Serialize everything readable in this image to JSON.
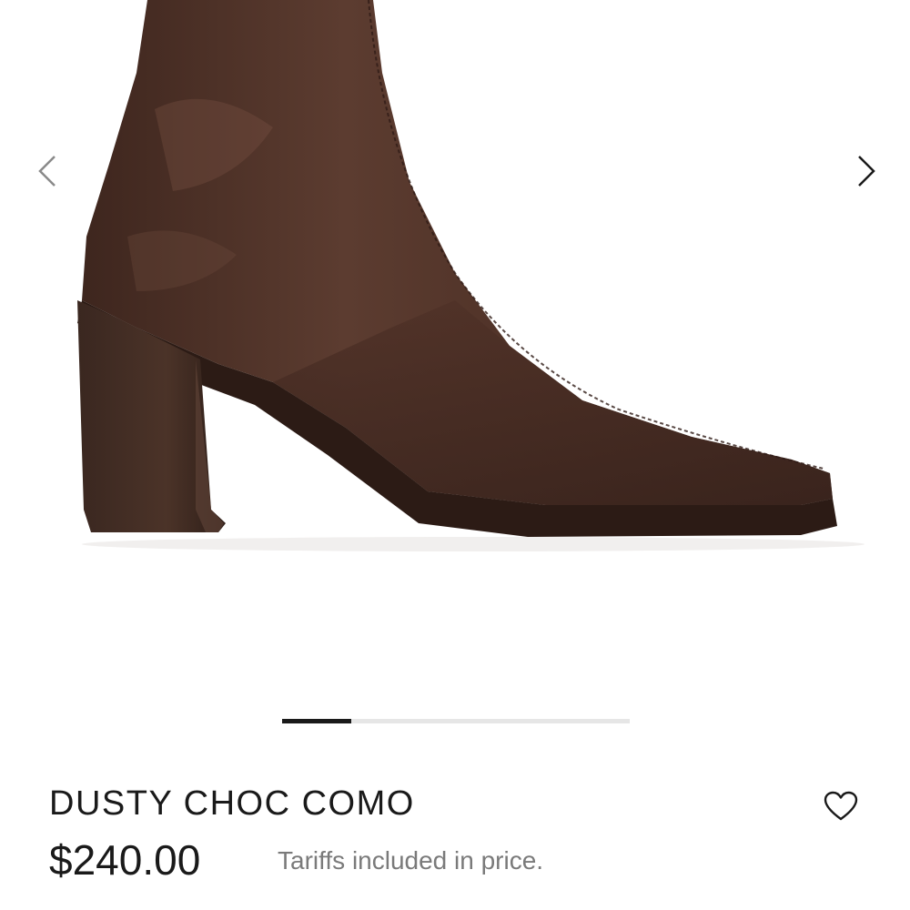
{
  "gallery": {
    "image_alt": "brown leather ankle boot with block heel",
    "icons": {
      "prev": "chevron-left-icon",
      "next": "chevron-right-icon"
    },
    "colors": {
      "boot": "#4a2e24",
      "heel": "#3b2720",
      "prev_arrow": "#8a8a8a",
      "next_arrow": "#1a1a1a"
    },
    "progress": {
      "current_fraction": 0.2
    }
  },
  "product": {
    "name": "DUSTY CHOC COMO",
    "price": "$240.00",
    "tariff_note": "Tariffs included in price.",
    "wishlist_icon": "heart-icon"
  }
}
